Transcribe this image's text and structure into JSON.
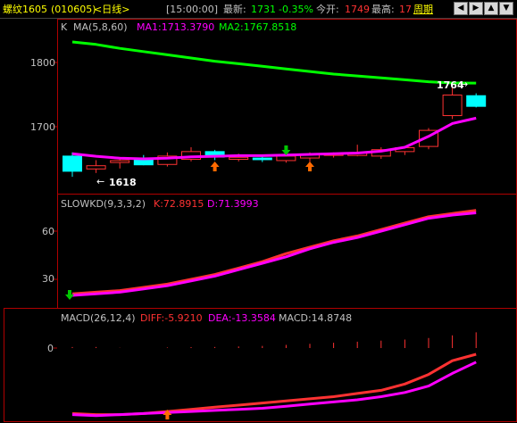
{
  "header": {
    "symbol": "螺纹1605",
    "code": "(010605)",
    "period": "<日线>",
    "time": "[15:00:00]",
    "latest_label": "最新:",
    "latest_value": "1731",
    "change_pct": "-0.35%",
    "open_label": "今开:",
    "open_value": "1749",
    "high_label": "最高:",
    "high_value": "17",
    "period_link": "周期"
  },
  "nav_icons": [
    "arrow-left-icon",
    "arrow-right-icon",
    "arrow-up-icon",
    "arrow-down-icon"
  ],
  "main_panel": {
    "k_label": "K",
    "ma_label": "MA(5,8,60)",
    "ma1": "MA1:1713.3790",
    "ma2": "MA2:1767.8518",
    "y_ticks": [
      "1800",
      "1700"
    ],
    "low_annot": "1618",
    "high_annot": "1764"
  },
  "kd_panel": {
    "label": "SLOWKD(9,3,3,2)",
    "k": "K:72.8915",
    "d": "D:71.3993",
    "y_ticks": [
      "60",
      "30"
    ]
  },
  "macd_panel": {
    "label": "MACD(26,12,4)",
    "diff": "DIFF:-5.9210",
    "dea": "DEA:-13.3584",
    "macd": "MACD:14.8748",
    "y_ticks": [
      "0"
    ]
  },
  "colors": {
    "up": "#ff3232",
    "down": "#00ffff",
    "ma1": "#ff00ff",
    "ma2": "#00ff00",
    "grid": "#b00000",
    "signal_up": "#ff6a00",
    "signal_down": "#00c800",
    "yellow": "#ffff00"
  },
  "chart_data": [
    {
      "type": "candlestick",
      "title": "螺纹1605 (010605) 日线",
      "ylim": [
        1610,
        1840
      ],
      "candles": [
        {
          "o": 1655,
          "h": 1660,
          "l": 1622,
          "c": 1630
        },
        {
          "o": 1635,
          "h": 1648,
          "l": 1628,
          "c": 1640
        },
        {
          "o": 1645,
          "h": 1652,
          "l": 1635,
          "c": 1648
        },
        {
          "o": 1652,
          "h": 1656,
          "l": 1640,
          "c": 1640
        },
        {
          "o": 1642,
          "h": 1660,
          "l": 1638,
          "c": 1655
        },
        {
          "o": 1650,
          "h": 1668,
          "l": 1646,
          "c": 1662
        },
        {
          "o": 1662,
          "h": 1664,
          "l": 1648,
          "c": 1652
        },
        {
          "o": 1650,
          "h": 1658,
          "l": 1646,
          "c": 1653
        },
        {
          "o": 1652,
          "h": 1656,
          "l": 1645,
          "c": 1648
        },
        {
          "o": 1648,
          "h": 1662,
          "l": 1644,
          "c": 1655
        },
        {
          "o": 1652,
          "h": 1660,
          "l": 1645,
          "c": 1657
        },
        {
          "o": 1656,
          "h": 1660,
          "l": 1652,
          "c": 1658
        },
        {
          "o": 1656,
          "h": 1672,
          "l": 1654,
          "c": 1660
        },
        {
          "o": 1655,
          "h": 1668,
          "l": 1650,
          "c": 1665
        },
        {
          "o": 1662,
          "h": 1670,
          "l": 1656,
          "c": 1668
        },
        {
          "o": 1670,
          "h": 1698,
          "l": 1665,
          "c": 1695
        },
        {
          "o": 1718,
          "h": 1762,
          "l": 1712,
          "c": 1750
        },
        {
          "o": 1749,
          "h": 1752,
          "l": 1730,
          "c": 1731
        }
      ],
      "ma1": [
        1658,
        1654,
        1651,
        1650,
        1651,
        1653,
        1654,
        1655,
        1655,
        1656,
        1657,
        1658,
        1659,
        1662,
        1668,
        1685,
        1705,
        1713.379
      ],
      "ma2": [
        1832,
        1828,
        1822,
        1817,
        1812,
        1807,
        1802,
        1798,
        1794,
        1790,
        1786,
        1782,
        1779,
        1776,
        1773,
        1770,
        1768,
        1767.8518
      ]
    },
    {
      "type": "line",
      "title": "SLOWKD(9,3,3,2)",
      "ylim": [
        20,
        80
      ],
      "series": [
        {
          "name": "K",
          "values": [
            21,
            22,
            23,
            25,
            27,
            30,
            33,
            37,
            41,
            46,
            50,
            54,
            57,
            61,
            65,
            69,
            71,
            72.8915
          ]
        },
        {
          "name": "D",
          "values": [
            20,
            21,
            22,
            24,
            26,
            29,
            32,
            36,
            40,
            44,
            49,
            53,
            56,
            60,
            64,
            68,
            70,
            71.3993
          ]
        }
      ]
    },
    {
      "type": "line",
      "title": "MACD(26,12,4)",
      "ylim": [
        -65,
        10
      ],
      "series": [
        {
          "name": "DIFF",
          "values": [
            -62,
            -63,
            -63,
            -62,
            -60,
            -58,
            -56,
            -54,
            -52,
            -50,
            -48,
            -46,
            -43,
            -40,
            -34,
            -25,
            -12,
            -5.921
          ]
        },
        {
          "name": "DEA",
          "values": [
            -63,
            -64,
            -63,
            -62,
            -61,
            -60,
            -59,
            -58,
            -57,
            -55,
            -53,
            -51,
            -49,
            -46,
            -42,
            -36,
            -24,
            -13.3584
          ]
        },
        {
          "name": "MACD",
          "values": [
            1,
            1,
            0.2,
            0,
            0.5,
            0.8,
            1,
            1.5,
            2,
            3,
            4,
            5,
            6,
            7,
            8,
            9.5,
            12,
            14.8748
          ]
        }
      ]
    }
  ]
}
